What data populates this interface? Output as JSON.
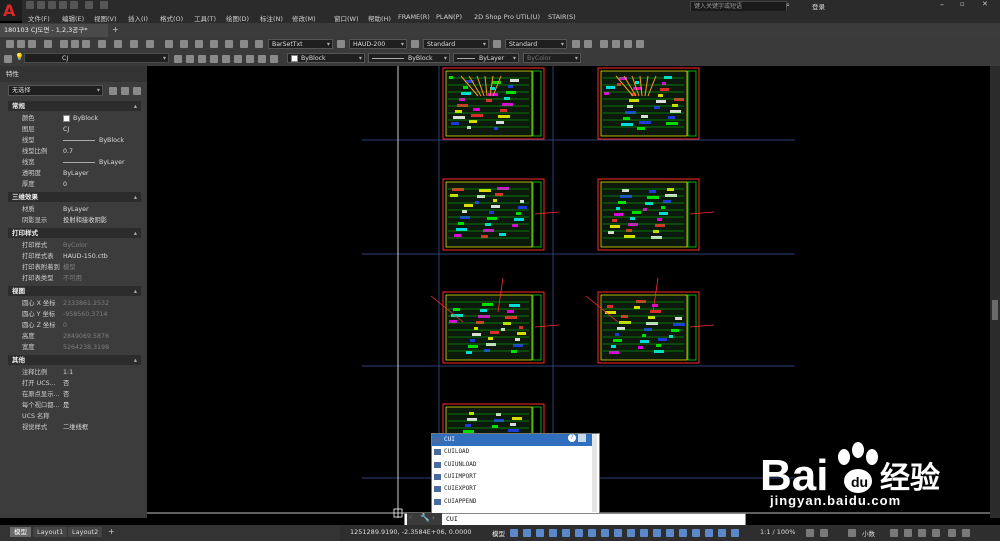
{
  "app": {
    "search_placeholder": "键入关键字或短语",
    "login_label": "登录",
    "doc_tab": "180103 CJ도면 - 1,2,3공구*",
    "menu": [
      "文件(F)",
      "编辑(E)",
      "视图(V)",
      "插入(I)",
      "格式(O)",
      "工具(T)",
      "绘图(D)",
      "标注(N)",
      "修改(M)",
      "窗口(W)",
      "帮助(H)",
      "FRAME(R)",
      "PLAN(P)",
      "2D Shop Pro",
      "UTIL(U)",
      "STAIR(S)"
    ]
  },
  "toolbar": {
    "text_style": "BarSetTxt",
    "dim_style": "HAUD-200",
    "table_style": "Standard",
    "multileader_style": "Standard",
    "layer": "CJ",
    "color": "ByBlock",
    "linetype": "ByBlock",
    "lineweight": "ByLayer",
    "plotstyle": "ByColor"
  },
  "properties": {
    "title": "特性",
    "selection": "无选择",
    "sections": [
      {
        "name": "常规",
        "rows": [
          {
            "label": "颜色",
            "value": "ByBlock"
          },
          {
            "label": "图层",
            "value": "CJ"
          },
          {
            "label": "线型",
            "value": "ByBlock"
          },
          {
            "label": "线型比例",
            "value": "0.7"
          },
          {
            "label": "线宽",
            "value": "ByLayer"
          },
          {
            "label": "透明度",
            "value": "ByLayer"
          },
          {
            "label": "厚度",
            "value": "0"
          }
        ]
      },
      {
        "name": "三维效果",
        "rows": [
          {
            "label": "材质",
            "value": "ByLayer"
          },
          {
            "label": "阴影显示",
            "value": "投射和接收阴影"
          }
        ]
      },
      {
        "name": "打印样式",
        "rows": [
          {
            "label": "打印样式",
            "value": "ByColor"
          },
          {
            "label": "打印样式表",
            "value": "HAUD-150.ctb"
          },
          {
            "label": "打印表附着到",
            "value": "模型"
          },
          {
            "label": "打印表类型",
            "value": "不可用"
          }
        ]
      },
      {
        "name": "视图",
        "rows": [
          {
            "label": "圆心 X 坐标",
            "value": "2333861.2532"
          },
          {
            "label": "圆心 Y 坐标",
            "value": "-958560.3714"
          },
          {
            "label": "圆心 Z 坐标",
            "value": "0"
          },
          {
            "label": "高度",
            "value": "2849069.5876"
          },
          {
            "label": "宽度",
            "value": "5264238.3198"
          }
        ]
      },
      {
        "name": "其他",
        "rows": [
          {
            "label": "注释比例",
            "value": "1:1"
          },
          {
            "label": "打开 UCS...",
            "value": "否"
          },
          {
            "label": "在原点显示...",
            "value": "否"
          },
          {
            "label": "每个视口都...",
            "value": "是"
          },
          {
            "label": "UCS 名称",
            "value": ""
          },
          {
            "label": "视觉样式",
            "value": "二维线框"
          }
        ]
      }
    ]
  },
  "autocomplete": {
    "items": [
      "CUI",
      "CUILOAD",
      "CUIUNLOAD",
      "CUIIMPORT",
      "CUIEXPORT",
      "CUIAPPEND"
    ]
  },
  "command": {
    "text": "CUI"
  },
  "layout_tabs": [
    "模型",
    "Layout1",
    "Layout2"
  ],
  "status": {
    "coords": "1251289.9190, -2.3584E+06, 0.0000",
    "model_label": "模型",
    "scale": "1:1 / 100%",
    "units": "小数"
  },
  "watermark": {
    "text": "jingyan.baidu.com",
    "brand": "Bai",
    "brand2": "经验"
  }
}
